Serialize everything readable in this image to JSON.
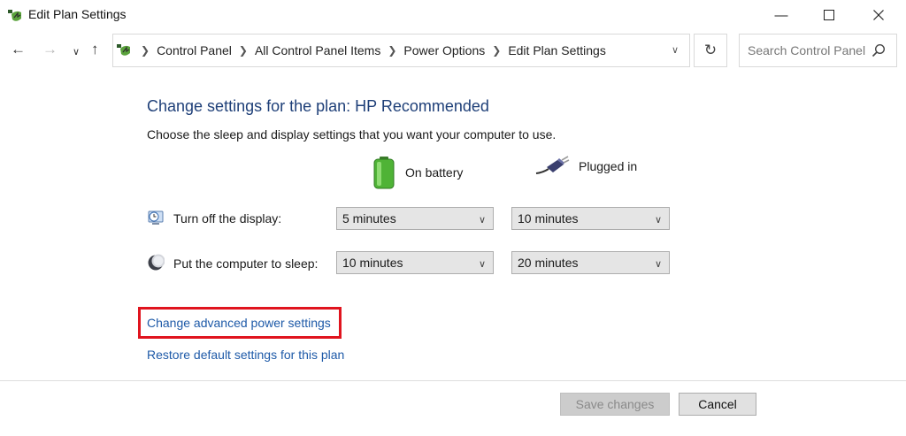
{
  "window": {
    "title": "Edit Plan Settings"
  },
  "address": {
    "breadcrumbs": [
      "Control Panel",
      "All Control Panel Items",
      "Power Options",
      "Edit Plan Settings"
    ]
  },
  "search": {
    "placeholder": "Search Control Panel"
  },
  "main": {
    "heading": "Change settings for the plan: HP Recommended",
    "subtext": "Choose the sleep and display settings that you want your computer to use.",
    "columns": {
      "battery": "On battery",
      "plugged": "Plugged in"
    },
    "rows": {
      "display": {
        "label": "Turn off the display:",
        "battery": "5 minutes",
        "plugged": "10 minutes"
      },
      "sleep": {
        "label": "Put the computer to sleep:",
        "battery": "10 minutes",
        "plugged": "20 minutes"
      }
    },
    "links": {
      "advanced": "Change advanced power settings",
      "restore": "Restore default settings for this plan"
    }
  },
  "footer": {
    "save": "Save changes",
    "cancel": "Cancel"
  },
  "colors": {
    "heading": "#1e3f78",
    "link": "#1e5aa8",
    "highlight": "#e0141e"
  }
}
